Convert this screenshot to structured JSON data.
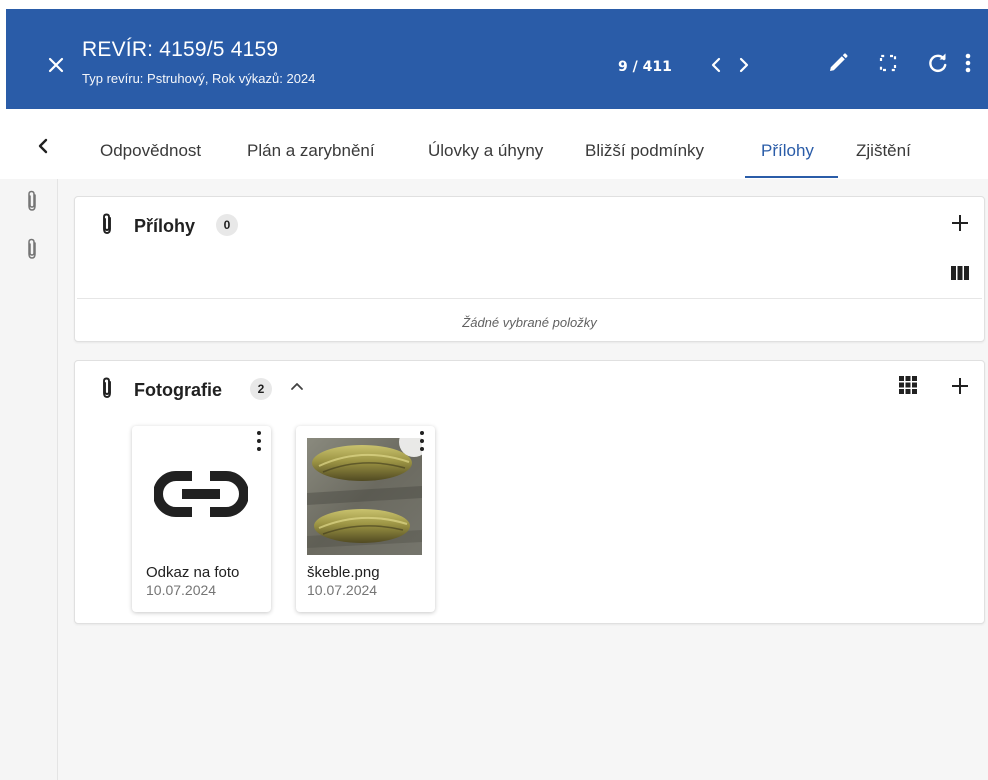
{
  "header": {
    "title": "REVÍR: 4159/5 4159",
    "subtitle": "Typ revíru: Pstruhový, Rok výkazů: 2024",
    "pager": "9 / 411",
    "color": "#2a5ca8",
    "icons": [
      "close-icon",
      "chevron-left-icon",
      "chevron-right-icon",
      "pencil-icon",
      "fullscreen-icon",
      "refresh-icon",
      "more-vert-icon"
    ]
  },
  "tabs": [
    {
      "label": "Odpovědnost"
    },
    {
      "label": "Plán a zarybnění"
    },
    {
      "label": "Úlovky a úhyny"
    },
    {
      "label": "Bližší podmínky"
    },
    {
      "label": "Přílohy",
      "active": true
    },
    {
      "label": "Zjištění"
    }
  ],
  "attachments": {
    "title": "Přílohy",
    "count": "0",
    "empty_text": "Žádné vybrané položky"
  },
  "photos": {
    "title": "Fotografie",
    "count": "2",
    "items": [
      {
        "name": "Odkaz na foto",
        "date": "10.07.2024",
        "kind": "link-icon"
      },
      {
        "name": "škeble.png",
        "date": "10.07.2024",
        "kind": "photo-thumbnail"
      }
    ]
  }
}
